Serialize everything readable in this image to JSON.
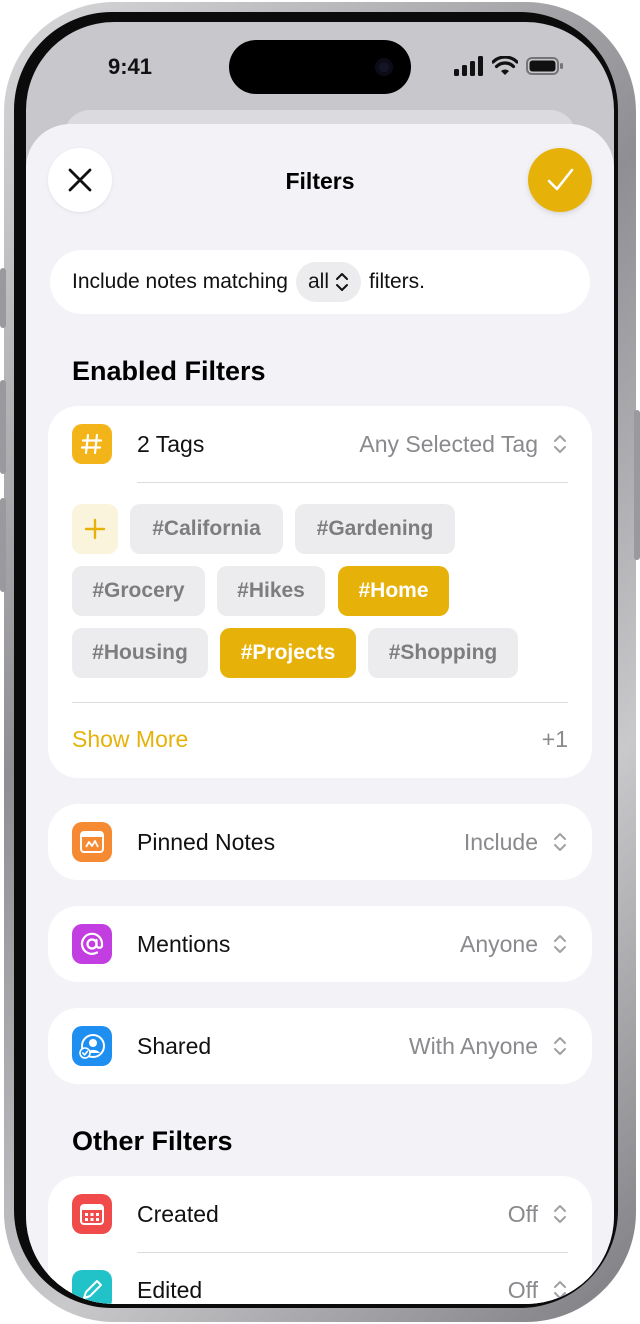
{
  "status": {
    "time": "9:41"
  },
  "sheet": {
    "title": "Filters",
    "match": {
      "prefix": "Include notes matching",
      "mode": "all",
      "suffix": "filters."
    }
  },
  "enabled_filters": {
    "heading": "Enabled Filters",
    "tags": {
      "label": "2 Tags",
      "value": "Any Selected Tag",
      "items": [
        {
          "name": "#California",
          "selected": false
        },
        {
          "name": "#Gardening",
          "selected": false
        },
        {
          "name": "#Grocery",
          "selected": false
        },
        {
          "name": "#Hikes",
          "selected": false
        },
        {
          "name": "#Home",
          "selected": true
        },
        {
          "name": "#Housing",
          "selected": false
        },
        {
          "name": "#Projects",
          "selected": true
        },
        {
          "name": "#Shopping",
          "selected": false
        }
      ],
      "show_more": "Show More",
      "more_count": "+1"
    },
    "pinned": {
      "label": "Pinned Notes",
      "value": "Include"
    },
    "mentions": {
      "label": "Mentions",
      "value": "Anyone"
    },
    "shared": {
      "label": "Shared",
      "value": "With Anyone"
    }
  },
  "other_filters": {
    "heading": "Other Filters",
    "created": {
      "label": "Created",
      "value": "Off"
    },
    "edited": {
      "label": "Edited",
      "value": "Off"
    }
  },
  "colors": {
    "accent": "#e6b20a",
    "tags_icon": "#f2b418",
    "pinned_icon": "#f58a33",
    "mentions_icon": "#c23ee0",
    "shared_icon": "#1e8ff0",
    "created_icon": "#f04a4a",
    "edited_icon": "#22c2c9"
  }
}
